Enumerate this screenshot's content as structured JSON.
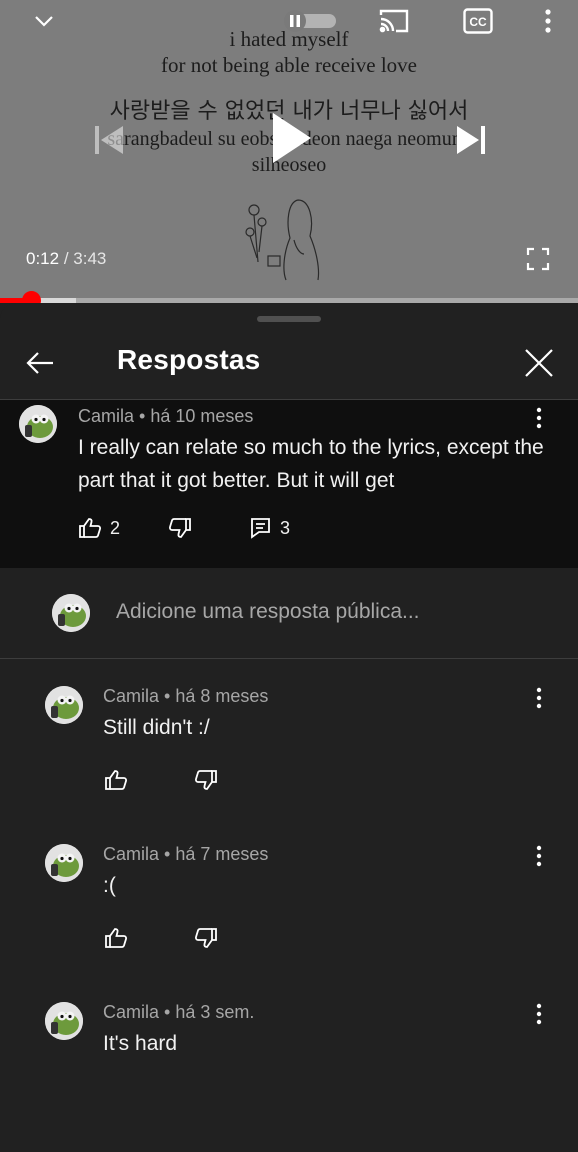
{
  "player": {
    "lyrics": {
      "line1": "i hated myself",
      "line2": "for not being able receive love",
      "korean": "사랑받을 수 없었던 내가 너무나 싫어서",
      "romanized1": "sarangbadeul su eobseotdeon naega neomuna",
      "romanized2": "silheoseo"
    },
    "time_current": "0:12",
    "time_separator": " / ",
    "time_total": "3:43",
    "progress_played_fraction": 0.053,
    "progress_buffered_fraction": 0.132,
    "icons": [
      "chevron-down-icon",
      "autoplay-pause-icon",
      "cast-icon",
      "captions-icon",
      "more-vert-icon",
      "skip-previous-icon",
      "play-icon",
      "skip-next-icon",
      "fullscreen-icon"
    ]
  },
  "sheet": {
    "title": "Respostas",
    "parent_comment": {
      "meta": "Camila • há 10 meses",
      "text": "I really can relate so much to the lyrics, except the part that it got better. But it will get",
      "likes": "2",
      "replies": "3"
    },
    "reply_placeholder": "Adicione uma resposta pública...",
    "replies": [
      {
        "meta": "Camila • há 8 meses",
        "text": "Still didn't :/"
      },
      {
        "meta": "Camila • há 7 meses",
        "text": ":("
      },
      {
        "meta": "Camila • há 3 sem.",
        "text": "It's hard"
      }
    ]
  },
  "colors": {
    "accent_red": "#ff0000",
    "sheet_bg": "#212121",
    "highlight_bg": "#0f0f0f"
  }
}
